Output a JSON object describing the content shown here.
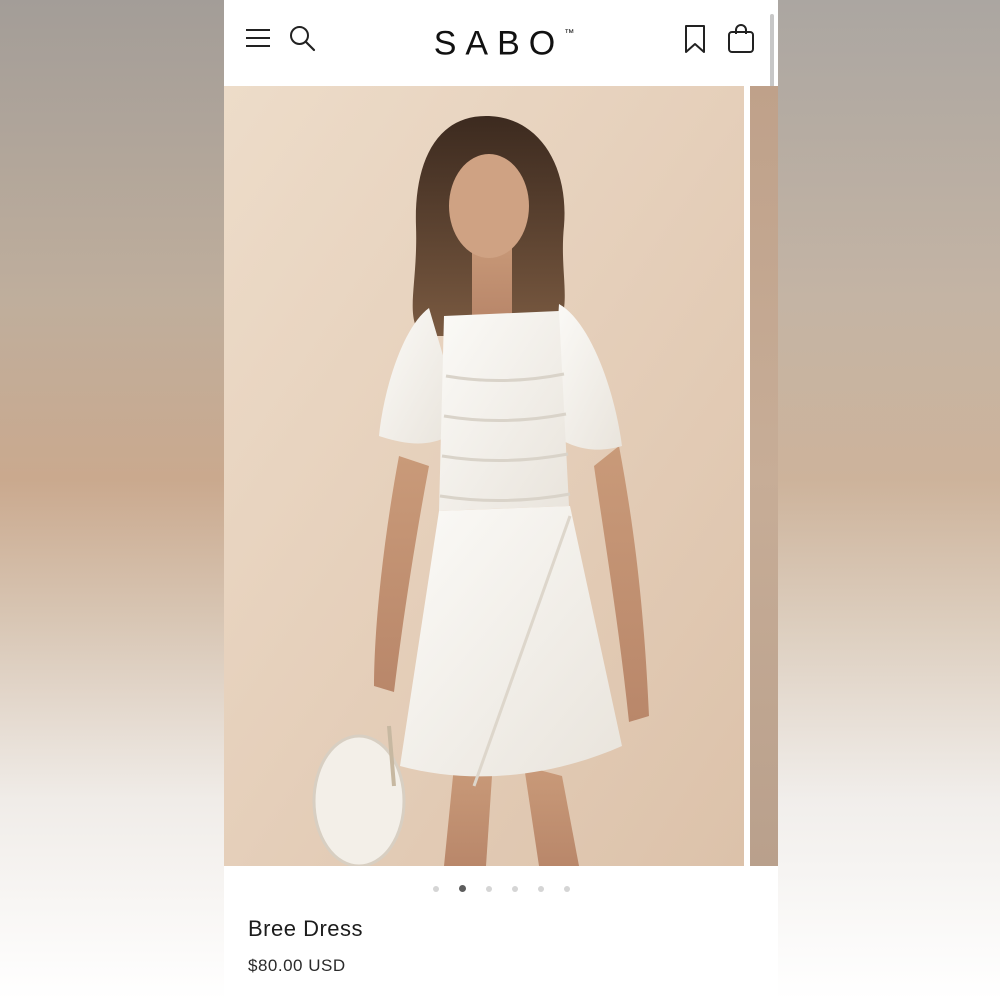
{
  "header": {
    "brand": "SABO",
    "trademark": "™",
    "icons": {
      "menu": "hamburger-menu-icon",
      "search": "search-icon",
      "wishlist": "bookmark-icon",
      "cart": "shopping-bag-icon"
    }
  },
  "product": {
    "image_alt": "Model wearing white ruched short-sleeve wrap mini dress holding a straw hat",
    "name": "Bree Dress",
    "price": "$80.00 USD"
  },
  "carousel": {
    "total_slides": 6,
    "active_index": 1
  },
  "colors": {
    "text": "#1c1c1c",
    "dot_inactive": "#d5d5d5",
    "dot_active": "#5d5d5d",
    "background": "#ffffff"
  }
}
